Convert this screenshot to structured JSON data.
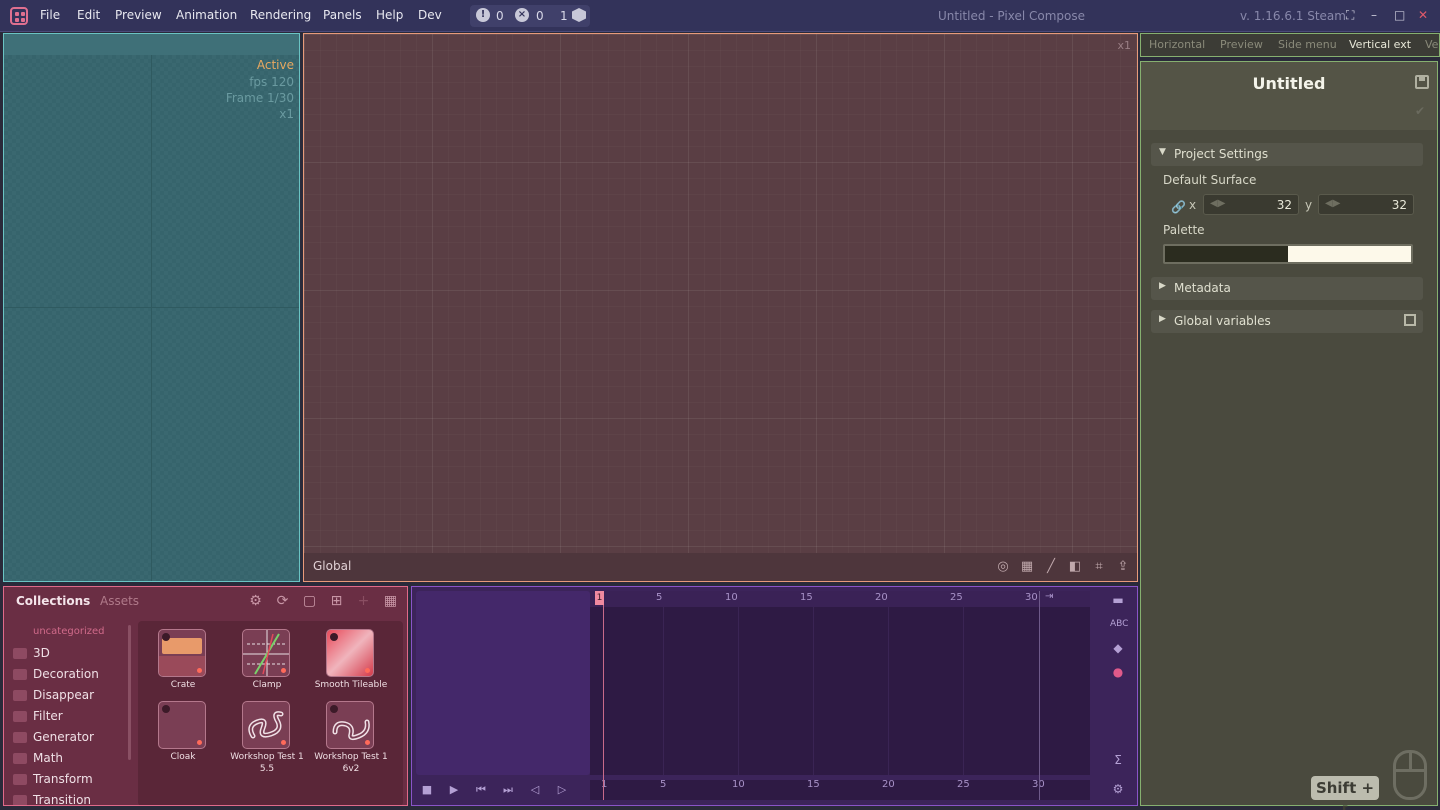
{
  "menubar": {
    "items": [
      "File",
      "Edit",
      "Preview",
      "Animation",
      "Rendering",
      "Panels",
      "Help",
      "Dev"
    ],
    "warnings": "0",
    "errors": "0",
    "tasks": "1",
    "window_title": "Untitled - Pixel Compose",
    "version": "v. 1.16.6.1 Steam"
  },
  "preview": {
    "status": "Active",
    "fps": "fps 120",
    "frame": "Frame 1/30",
    "zoom": "x1"
  },
  "graph": {
    "zoom": "x1",
    "context": "Global"
  },
  "right_tabs": [
    "Horizontal",
    "Preview",
    "Side menu",
    "Vertical ext",
    "Ve"
  ],
  "inspector": {
    "title": "Untitled",
    "sections": {
      "project_settings": "Project Settings",
      "metadata": "Metadata",
      "global_variables": "Global variables"
    },
    "default_surface_label": "Default Surface",
    "x_label": "x",
    "y_label": "y",
    "surface_x": "32",
    "surface_y": "32",
    "palette_label": "Palette",
    "palette_colors": [
      "#2b2c1f",
      "#fdf9ea"
    ],
    "shortcut": "Shift + ["
  },
  "collections": {
    "tabs": [
      "Collections",
      "Assets"
    ],
    "uncategorized": "uncategorized",
    "folders": [
      "3D",
      "Decoration",
      "Disappear",
      "Filter",
      "Generator",
      "Math",
      "Transform",
      "Transition"
    ],
    "assets": [
      "Crate",
      "Clamp",
      "Smooth Tileable",
      "Cloak",
      "Workshop Test 1 5.5",
      "Workshop Test 1 6v2"
    ]
  },
  "timeline": {
    "current_frame": "1",
    "ticks": [
      "5",
      "10",
      "15",
      "20",
      "25",
      "30"
    ],
    "bottom_ticks": [
      "1",
      "5",
      "10",
      "15",
      "20",
      "25",
      "30"
    ]
  },
  "colors": {
    "preview_border": "#6ac4c4",
    "graph_border": "#e89a7a",
    "inspector_border": "#86b070",
    "collections_border": "#e06a8a",
    "timeline_border": "#8a54c8"
  }
}
